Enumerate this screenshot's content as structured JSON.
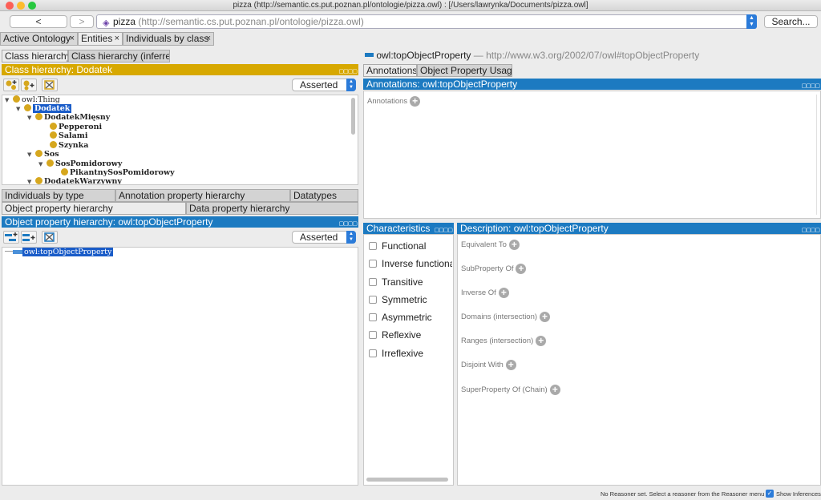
{
  "window": {
    "title": "pizza (http://semantic.cs.put.poznan.pl/ontologie/pizza.owl)  : [/Users/lawrynka/Documents/pizza.owl]"
  },
  "toolbar": {
    "back_label": "<",
    "forward_label": ">",
    "ontology_name": "pizza",
    "ontology_url": "(http://semantic.cs.put.poznan.pl/ontologie/pizza.owl)",
    "search_label": "Search..."
  },
  "tabs": [
    {
      "label": "Active Ontology"
    },
    {
      "label": "Entities"
    },
    {
      "label": "Individuals by class"
    }
  ],
  "left": {
    "class_tabs": [
      "Class hierarchy",
      "Class hierarchy (inferred)"
    ],
    "class_header": "Class hierarchy: Dodatek",
    "class_mode": "Asserted",
    "tree": [
      {
        "label": "owl:Thing",
        "toggle": "▼"
      },
      {
        "label": "Dodatek",
        "toggle": "▼"
      },
      {
        "label": "DodatekMięsny",
        "toggle": "▼"
      },
      {
        "label": "Pepperoni",
        "toggle": ""
      },
      {
        "label": "Salami",
        "toggle": ""
      },
      {
        "label": "Szynka",
        "toggle": ""
      },
      {
        "label": "Sos",
        "toggle": "▼"
      },
      {
        "label": "SosPomidorowy",
        "toggle": "▼"
      },
      {
        "label": "PikantnySosPomidorowy",
        "toggle": ""
      },
      {
        "label": "DodatekWarzywny",
        "toggle": "▼"
      }
    ],
    "bottom_tabs_row1": [
      "Individuals by type",
      "Annotation property hierarchy",
      "Datatypes"
    ],
    "bottom_tabs_row2": [
      "Object property hierarchy",
      "Data property hierarchy"
    ],
    "objprop_header": "Object property hierarchy: owl:topObjectProperty",
    "objprop_mode": "Asserted",
    "objprop_item": "owl:topObjectProperty"
  },
  "right": {
    "entity_name": "owl:topObjectProperty",
    "entity_iri": "— http://www.w3.org/2002/07/owl#topObjectProperty",
    "tabs": [
      "Annotations",
      "Object Property Usage"
    ],
    "annotations_header": "Annotations: owl:topObjectProperty",
    "annotations_label": "Annotations",
    "characteristics_header": "Characteristics",
    "characteristics": [
      "Functional",
      "Inverse functiona",
      "Transitive",
      "Symmetric",
      "Asymmetric",
      "Reflexive",
      "Irreflexive"
    ],
    "description_header": "Description: owl:topObjectProperty",
    "description_items": [
      "Equivalent To",
      "SubProperty Of",
      "Inverse Of",
      "Domains (intersection)",
      "Ranges (intersection)",
      "Disjoint With",
      "SuperProperty Of (Chain)"
    ]
  },
  "status": {
    "message": "No Reasoner set. Select a reasoner from the Reasoner menu",
    "show_inferences": "Show Inferences"
  },
  "colors": {
    "class_accent": "#d7a800",
    "property_accent": "#1c7ac1",
    "selection": "#1a5cc8"
  }
}
